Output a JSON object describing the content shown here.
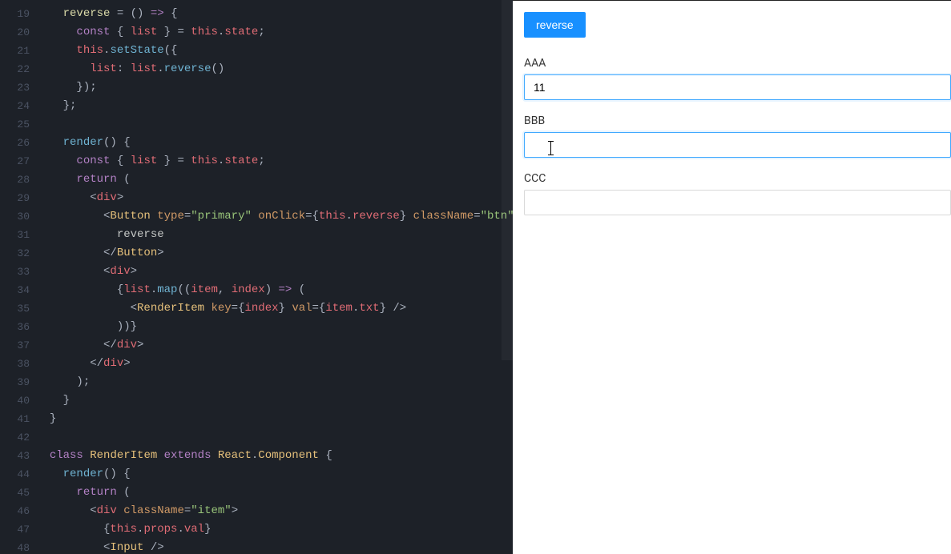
{
  "editor": {
    "first_line_number": 19,
    "lines": [
      {
        "n": 19,
        "html": "    <span class='c-prop'>reverse</span> <span class='c-punc'>=</span> <span class='c-punc'>()</span> <span class='c-key'>=&gt;</span> <span class='c-punc'>{</span>"
      },
      {
        "n": 20,
        "html": "      <span class='c-key'>const</span> <span class='c-punc'>{</span> <span class='c-var'>list</span> <span class='c-punc'>}</span> <span class='c-punc'>=</span> <span class='c-this'>this</span><span class='c-dot'>.</span><span class='c-var'>state</span><span class='c-punc'>;</span>"
      },
      {
        "n": 21,
        "html": "      <span class='c-this'>this</span><span class='c-dot'>.</span><span class='c-fn'>setState</span><span class='c-punc'>({</span>"
      },
      {
        "n": 22,
        "html": "        <span class='c-var'>list</span><span class='c-punc'>:</span> <span class='c-var'>list</span><span class='c-dot'>.</span><span class='c-fn'>reverse</span><span class='c-punc'>()</span>"
      },
      {
        "n": 23,
        "html": "      <span class='c-punc'>});</span>"
      },
      {
        "n": 24,
        "html": "    <span class='c-punc'>};</span>"
      },
      {
        "n": 25,
        "html": ""
      },
      {
        "n": 26,
        "html": "    <span class='c-fn'>render</span><span class='c-punc'>()</span> <span class='c-punc'>{</span>"
      },
      {
        "n": 27,
        "html": "      <span class='c-key'>const</span> <span class='c-punc'>{</span> <span class='c-var'>list</span> <span class='c-punc'>}</span> <span class='c-punc'>=</span> <span class='c-this'>this</span><span class='c-dot'>.</span><span class='c-var'>state</span><span class='c-punc'>;</span>"
      },
      {
        "n": 28,
        "html": "      <span class='c-key'>return</span> <span class='c-punc'>(</span>"
      },
      {
        "n": 29,
        "html": "        <span class='c-punc'>&lt;</span><span class='c-tag'>div</span><span class='c-punc'>&gt;</span>"
      },
      {
        "n": 30,
        "html": "          <span class='c-punc'>&lt;</span><span class='c-type'>Button</span> <span class='c-attr'>type</span><span class='c-punc'>=</span><span class='c-str'>\"primary\"</span> <span class='c-attr'>onClick</span><span class='c-punc'>={</span><span class='c-this'>this</span><span class='c-dot'>.</span><span class='c-var'>reverse</span><span class='c-punc'>}</span> <span class='c-attr'>className</span><span class='c-punc'>=</span><span class='c-str'>\"btn\"</span><span class='c-punc'>&gt;</span>"
      },
      {
        "n": 31,
        "html": "            reverse"
      },
      {
        "n": 32,
        "html": "          <span class='c-punc'>&lt;/</span><span class='c-type'>Button</span><span class='c-punc'>&gt;</span>"
      },
      {
        "n": 33,
        "html": "          <span class='c-punc'>&lt;</span><span class='c-tag'>div</span><span class='c-punc'>&gt;</span>"
      },
      {
        "n": 34,
        "html": "            <span class='c-punc'>{</span><span class='c-var'>list</span><span class='c-dot'>.</span><span class='c-fn'>map</span><span class='c-punc'>((</span><span class='c-var'>item</span><span class='c-punc'>,</span> <span class='c-var'>index</span><span class='c-punc'>)</span> <span class='c-key'>=&gt;</span> <span class='c-punc'>(</span>"
      },
      {
        "n": 35,
        "html": "              <span class='c-punc'>&lt;</span><span class='c-type'>RenderItem</span> <span class='c-attr'>key</span><span class='c-punc'>={</span><span class='c-var'>index</span><span class='c-punc'>}</span> <span class='c-attr'>val</span><span class='c-punc'>={</span><span class='c-var'>item</span><span class='c-dot'>.</span><span class='c-var'>txt</span><span class='c-punc'>}</span> <span class='c-punc'>/&gt;</span>"
      },
      {
        "n": 36,
        "html": "            <span class='c-punc'>))</span><span class='c-punc'>}</span>"
      },
      {
        "n": 37,
        "html": "          <span class='c-punc'>&lt;/</span><span class='c-tag'>div</span><span class='c-punc'>&gt;</span>"
      },
      {
        "n": 38,
        "html": "        <span class='c-punc'>&lt;/</span><span class='c-tag'>div</span><span class='c-punc'>&gt;</span>"
      },
      {
        "n": 39,
        "html": "      <span class='c-punc'>);</span>"
      },
      {
        "n": 40,
        "html": "    <span class='c-punc'>}</span>"
      },
      {
        "n": 41,
        "html": "  <span class='c-punc'>}</span>"
      },
      {
        "n": 42,
        "html": ""
      },
      {
        "n": 43,
        "html": "  <span class='c-key'>class</span> <span class='c-type'>RenderItem</span> <span class='c-key'>extends</span> <span class='c-type'>React</span><span class='c-dot'>.</span><span class='c-type'>Component</span> <span class='c-punc'>{</span>"
      },
      {
        "n": 44,
        "html": "    <span class='c-fn'>render</span><span class='c-punc'>()</span> <span class='c-punc'>{</span>"
      },
      {
        "n": 45,
        "html": "      <span class='c-key'>return</span> <span class='c-punc'>(</span>"
      },
      {
        "n": 46,
        "html": "        <span class='c-punc'>&lt;</span><span class='c-tag'>div</span> <span class='c-attr'>className</span><span class='c-punc'>=</span><span class='c-str'>\"item\"</span><span class='c-punc'>&gt;</span>"
      },
      {
        "n": 47,
        "html": "          <span class='c-punc'>{</span><span class='c-this'>this</span><span class='c-dot'>.</span><span class='c-var'>props</span><span class='c-dot'>.</span><span class='c-var'>val</span><span class='c-punc'>}</span>"
      },
      {
        "n": 48,
        "html": "          <span class='c-punc'>&lt;</span><span class='c-type'>Input</span> <span class='c-punc'>/&gt;</span>"
      }
    ]
  },
  "preview": {
    "button_label": "reverse",
    "items": [
      {
        "label": "AAA",
        "value": "11",
        "focused": true,
        "cursor": false
      },
      {
        "label": "BBB",
        "value": "",
        "focused": true,
        "cursor": true
      },
      {
        "label": "CCC",
        "value": "",
        "focused": false,
        "cursor": false
      }
    ]
  }
}
